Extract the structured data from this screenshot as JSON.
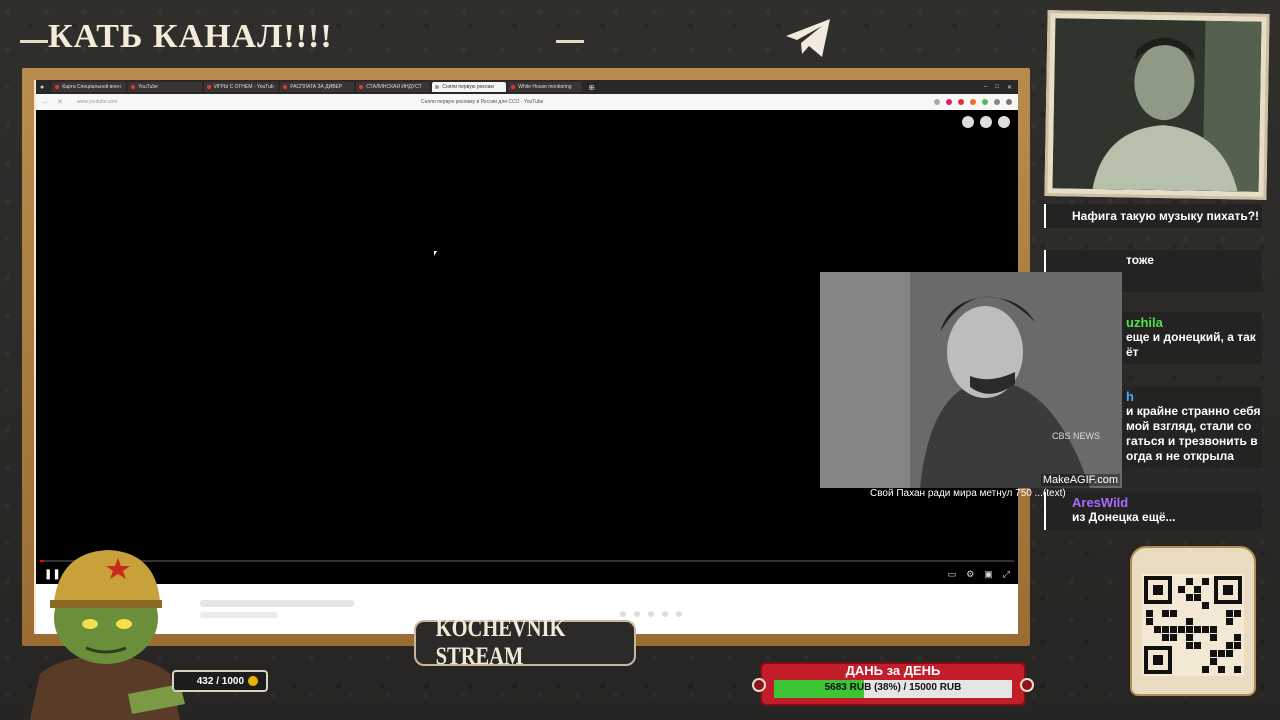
{
  "overlay": {
    "banner_text": "КАТЬ КАНАЛ!!!!",
    "stream_logo": "KOCHEVNIK STREAM",
    "xp_counter": "432 / 1000",
    "goal": {
      "title": "ДАНЬ за ДЕНЬ",
      "current": 5683,
      "target": 15000,
      "percent": 38,
      "text": "5683 RUB (38%) / 15000 RUB",
      "fill_color": "#3ec535",
      "box_color": "#c21d28"
    },
    "gif": {
      "watermark": "MakeAGIF.com",
      "broadcaster": "CBS NEWS",
      "caption": "Свой Пахан  ради мира метнул 750  ...(text)"
    }
  },
  "browser": {
    "tabs": [
      {
        "label": "Карта Специальной воен"
      },
      {
        "label": "YouTube"
      },
      {
        "label": "ИГРЫ С ОГНЕМ - YouTub"
      },
      {
        "label": "РАСПЛАТА ЗА ДИВЕР"
      },
      {
        "label": "СТАЛИНСКАЯ ИНДУСТ"
      },
      {
        "label": "Сняли первую реклам"
      },
      {
        "label": "White House monitoring"
      }
    ],
    "address": "www.youtube.com",
    "page_title": "Сняли первую рекламу в России для ССО - YouTube"
  },
  "chat": {
    "messages": [
      {
        "user": "",
        "text": "Нафига такую музыку пихать?!",
        "color": "#ffffff"
      },
      {
        "user": "",
        "text": "тоже",
        "color": "#4a7cff"
      },
      {
        "user": "uzhila",
        "text": "еще и донецкий, а так ёт",
        "color": "#4ce24c"
      },
      {
        "user": "h",
        "text": "и крайне странно себя мой взгляд, стали со гаться и трезвонить в огда я не открыла",
        "color": "#4aa8ff"
      },
      {
        "user": "AresWild",
        "text": "из Донецка ещё...",
        "color": "#a66cff"
      }
    ]
  }
}
